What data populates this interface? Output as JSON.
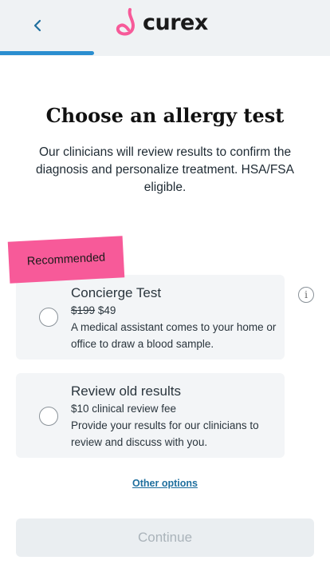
{
  "header": {
    "logo_text": "curex",
    "brand_color": "#f75a99",
    "progress_fraction": 0.29
  },
  "page": {
    "title": "Choose an allergy test",
    "subtitle": "Our clinicians will review results to confirm the diagnosis and personalize treatment. HSA/FSA eligible."
  },
  "badge": {
    "label": "Recommended",
    "color": "#f75a99"
  },
  "options": [
    {
      "title": "Concierge Test",
      "price_old": "$199",
      "price_new": "$49",
      "description": "A medical assistant comes to your home or office to draw a blood sample."
    },
    {
      "title": "Review old results",
      "price_line": "$10 clinical review fee",
      "description": "Provide your results for our clinicians to review and discuss with you."
    }
  ],
  "info_icon": "info-icon",
  "other_options_label": "Other options",
  "continue_label": "Continue"
}
